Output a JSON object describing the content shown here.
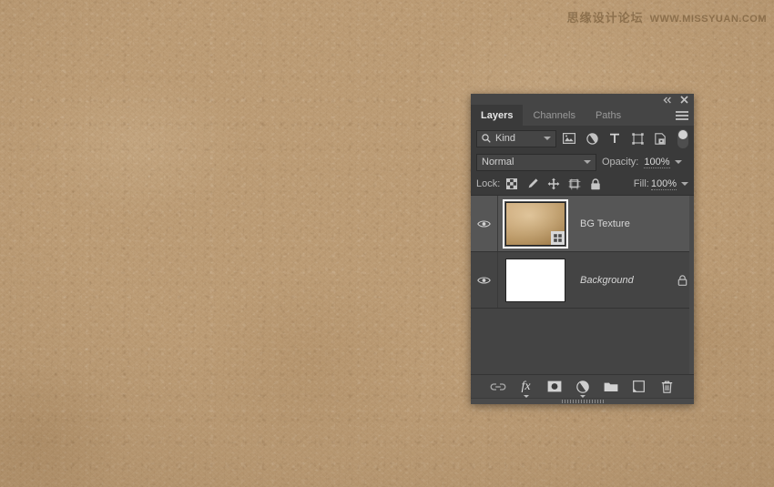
{
  "watermark": {
    "cn_text": "思缘设计论坛",
    "en_text": "WWW.MISSYUAN.COM"
  },
  "canvas": {
    "background_description": "tan leather texture",
    "background_color": "#bc9c75"
  },
  "layers_panel": {
    "titlebar": {
      "collapse_label": "«",
      "close_label": "✕"
    },
    "tabs": [
      {
        "label": "Layers",
        "active": true
      },
      {
        "label": "Channels",
        "active": false
      },
      {
        "label": "Paths",
        "active": false
      }
    ],
    "menu_icon": "hamburger-menu-icon",
    "filter_row": {
      "kind_label": "Kind",
      "search_icon": "search-icon",
      "filter_icons": [
        "pixel-layer-filter-icon",
        "adjustment-layer-filter-icon",
        "type-layer-filter-icon",
        "shape-layer-filter-icon",
        "smart-object-filter-icon"
      ],
      "toggle_name": "filter-enable-toggle"
    },
    "blend_row": {
      "blend_mode": "Normal",
      "opacity_label": "Opacity:",
      "opacity_value": "100%"
    },
    "lock_row": {
      "lock_label": "Lock:",
      "lock_icons": [
        "lock-transparency-icon",
        "lock-image-pixels-icon",
        "lock-position-icon",
        "lock-artboard-nesting-icon",
        "lock-all-icon"
      ],
      "fill_label": "Fill:",
      "fill_value": "100%"
    },
    "layers": [
      {
        "name": "BG Texture",
        "visible": true,
        "selected": true,
        "italic": false,
        "locked": false,
        "thumbnail_type": "texture",
        "smart_object_badge": true
      },
      {
        "name": "Background",
        "visible": true,
        "selected": false,
        "italic": true,
        "locked": true,
        "thumbnail_type": "white",
        "smart_object_badge": false
      }
    ],
    "bottom_toolbar": [
      {
        "name": "link-layers-icon",
        "label": "link"
      },
      {
        "name": "layer-style-fx-icon",
        "label": "fx"
      },
      {
        "name": "add-layer-mask-icon",
        "label": "mask"
      },
      {
        "name": "adjustment-layer-icon",
        "label": "adjustment"
      },
      {
        "name": "new-group-icon",
        "label": "folder"
      },
      {
        "name": "new-layer-icon",
        "label": "new layer"
      },
      {
        "name": "delete-layer-icon",
        "label": "delete"
      }
    ]
  }
}
